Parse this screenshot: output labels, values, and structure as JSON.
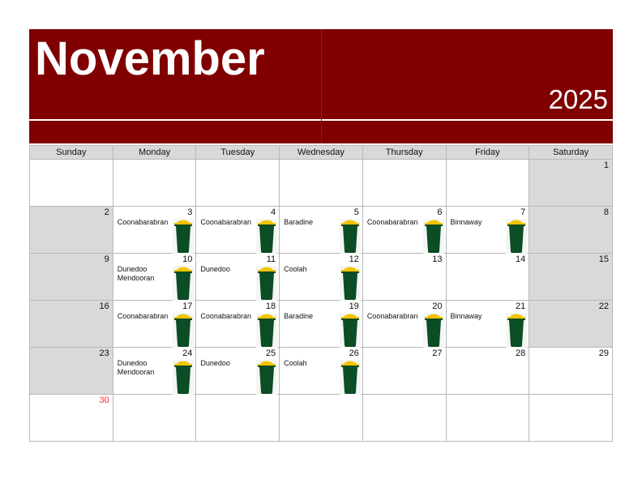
{
  "header": {
    "month": "November",
    "year": "2025"
  },
  "colors": {
    "banner": "#800000",
    "weekend": "#d9d9d9",
    "bin_body": "#0b4d24",
    "bin_lid": "#f2c300",
    "out_of_month_day": "#ff2b2b"
  },
  "weekdays": [
    "Sunday",
    "Monday",
    "Tuesday",
    "Wednesday",
    "Thursday",
    "Friday",
    "Saturday"
  ],
  "weeks": [
    [
      {
        "day": "",
        "location": "",
        "bin": false
      },
      {
        "day": "",
        "location": "",
        "bin": false
      },
      {
        "day": "",
        "location": "",
        "bin": false
      },
      {
        "day": "",
        "location": "",
        "bin": false
      },
      {
        "day": "",
        "location": "",
        "bin": false
      },
      {
        "day": "",
        "location": "",
        "bin": false
      },
      {
        "day": "1",
        "location": "",
        "bin": false
      }
    ],
    [
      {
        "day": "2",
        "location": "",
        "bin": false
      },
      {
        "day": "3",
        "location": "Coonabarabran",
        "bin": true
      },
      {
        "day": "4",
        "location": "Coonabarabran",
        "bin": true
      },
      {
        "day": "5",
        "location": "Baradine",
        "bin": true
      },
      {
        "day": "6",
        "location": "Coonabarabran",
        "bin": true
      },
      {
        "day": "7",
        "location": "Binnaway",
        "bin": true
      },
      {
        "day": "8",
        "location": "",
        "bin": false
      }
    ],
    [
      {
        "day": "9",
        "location": "",
        "bin": false
      },
      {
        "day": "10",
        "location": "Dunedoo\nMendooran",
        "bin": true
      },
      {
        "day": "11",
        "location": "Dunedoo",
        "bin": true
      },
      {
        "day": "12",
        "location": "Coolah",
        "bin": true
      },
      {
        "day": "13",
        "location": "",
        "bin": false
      },
      {
        "day": "14",
        "location": "",
        "bin": false
      },
      {
        "day": "15",
        "location": "",
        "bin": false
      }
    ],
    [
      {
        "day": "16",
        "location": "",
        "bin": false
      },
      {
        "day": "17",
        "location": "Coonabarabran",
        "bin": true
      },
      {
        "day": "18",
        "location": "Coonabarabran",
        "bin": true
      },
      {
        "day": "19",
        "location": "Baradine",
        "bin": true
      },
      {
        "day": "20",
        "location": "Coonabarabran",
        "bin": true
      },
      {
        "day": "21",
        "location": "Binnaway",
        "bin": true
      },
      {
        "day": "22",
        "location": "",
        "bin": false
      }
    ],
    [
      {
        "day": "23",
        "location": "",
        "bin": false
      },
      {
        "day": "24",
        "location": "Dunedoo\nMendooran",
        "bin": true
      },
      {
        "day": "25",
        "location": "Dunedoo",
        "bin": true
      },
      {
        "day": "26",
        "location": "Coolah",
        "bin": true
      },
      {
        "day": "27",
        "location": "",
        "bin": false
      },
      {
        "day": "28",
        "location": "",
        "bin": false
      },
      {
        "day": "29",
        "location": "",
        "bin": false
      }
    ],
    [
      {
        "day": "30",
        "location": "",
        "bin": false
      },
      {
        "day": "",
        "location": "",
        "bin": false
      },
      {
        "day": "",
        "location": "",
        "bin": false
      },
      {
        "day": "",
        "location": "",
        "bin": false
      },
      {
        "day": "",
        "location": "",
        "bin": false
      },
      {
        "day": "",
        "location": "",
        "bin": false
      },
      {
        "day": "",
        "location": "",
        "bin": false
      }
    ]
  ]
}
